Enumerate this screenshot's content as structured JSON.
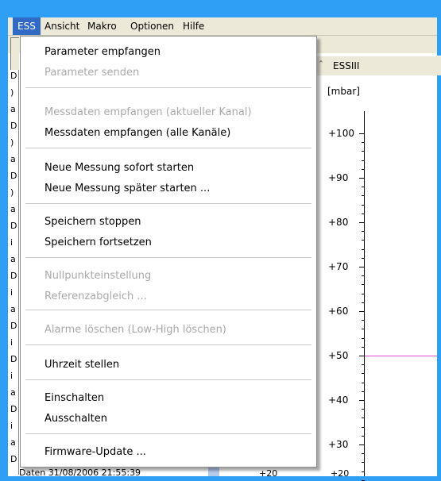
{
  "menubar": {
    "items": [
      {
        "label": "ESS"
      },
      {
        "label": "Ansicht"
      },
      {
        "label": "Makro"
      },
      {
        "label": "Optionen"
      },
      {
        "label": "Hilfe"
      }
    ]
  },
  "dropdown": {
    "items": [
      {
        "label": "Parameter empfangen",
        "enabled": true
      },
      {
        "label": "Parameter senden",
        "enabled": false
      },
      {
        "label": "Messdaten empfangen (aktueller Kanal)",
        "enabled": false
      },
      {
        "label": "Messdaten empfangen (alle Kanäle)",
        "enabled": true
      },
      {
        "label": "Neue Messung sofort starten",
        "enabled": true
      },
      {
        "label": "Neue Messung später starten ...",
        "enabled": true
      },
      {
        "label": "Speichern stoppen",
        "enabled": true
      },
      {
        "label": "Speichern fortsetzen",
        "enabled": true
      },
      {
        "label": "Nullpunkteinstellung",
        "enabled": false
      },
      {
        "label": "Referenzabgleich ...",
        "enabled": false
      },
      {
        "label": "Alarme löschen (Low-High löschen)",
        "enabled": false
      },
      {
        "label": "Uhrzeit stellen",
        "enabled": true
      },
      {
        "label": "Einschalten",
        "enabled": true
      },
      {
        "label": "Ausschalten",
        "enabled": true
      },
      {
        "label": "Firmware-Update ...",
        "enabled": true
      }
    ]
  },
  "chart_tab": {
    "label": "ESSIII"
  },
  "chart_data": {
    "type": "line",
    "ylabel": "[mbar]",
    "tick_labels": [
      "+100",
      "+90",
      "+80",
      "+70",
      "+60",
      "+50",
      "+40",
      "+30"
    ],
    "series": [
      {
        "values": [
          50
        ],
        "color": "#e34ad6"
      }
    ]
  },
  "left_panel": {
    "letters": [
      "D",
      ")",
      "a",
      "D",
      ")",
      "a",
      "D",
      ")",
      "a",
      "D",
      "i",
      "a",
      "D",
      "i",
      "a",
      "D",
      "i",
      "D",
      "i",
      "a",
      "D",
      "i",
      "a",
      "D"
    ]
  },
  "status": {
    "text": "Daten   31/08/2006 21:55:39"
  },
  "bottom_partial": {
    "left": "+20",
    "right": "+20"
  },
  "colors": {
    "menu_highlight": "#316ac5",
    "frame": "#2f9ff6",
    "series": "#e34ad6"
  }
}
